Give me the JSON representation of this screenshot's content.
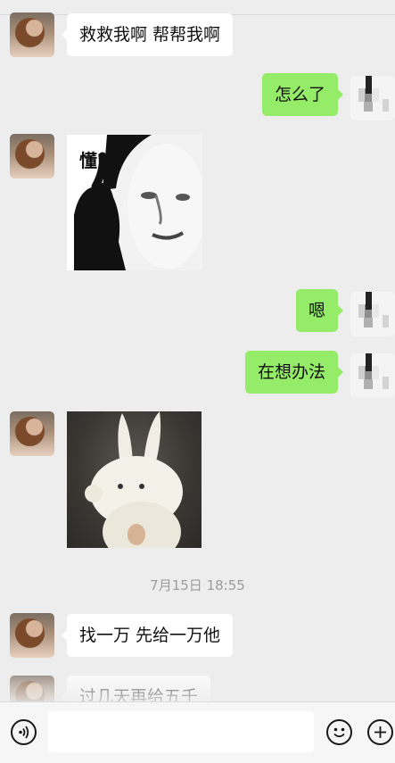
{
  "messages": [
    {
      "side": "left",
      "type": "text",
      "text": "救救我啊 帮帮我啊"
    },
    {
      "side": "right",
      "type": "text",
      "text": "怎么了"
    },
    {
      "side": "left",
      "type": "sticker",
      "sticker": "panda-face-dong",
      "caption": "懂?"
    },
    {
      "side": "right",
      "type": "text",
      "text": "嗯"
    },
    {
      "side": "right",
      "type": "text",
      "text": "在想办法"
    },
    {
      "side": "left",
      "type": "sticker",
      "sticker": "white-rabbit"
    },
    {
      "side": "left",
      "type": "text",
      "text": "找一万  先给一万他"
    },
    {
      "side": "left",
      "type": "text",
      "text": "过几天再给五千"
    }
  ],
  "timestamp": "7月15日 18:55",
  "colors": {
    "background": "#ededed",
    "incoming_bubble": "#ffffff",
    "outgoing_bubble": "#95ec69",
    "timestamp_text": "#9c9c9c"
  },
  "icons": {
    "voice": "voice-icon",
    "emoji": "emoji-icon",
    "plus": "plus-icon"
  }
}
